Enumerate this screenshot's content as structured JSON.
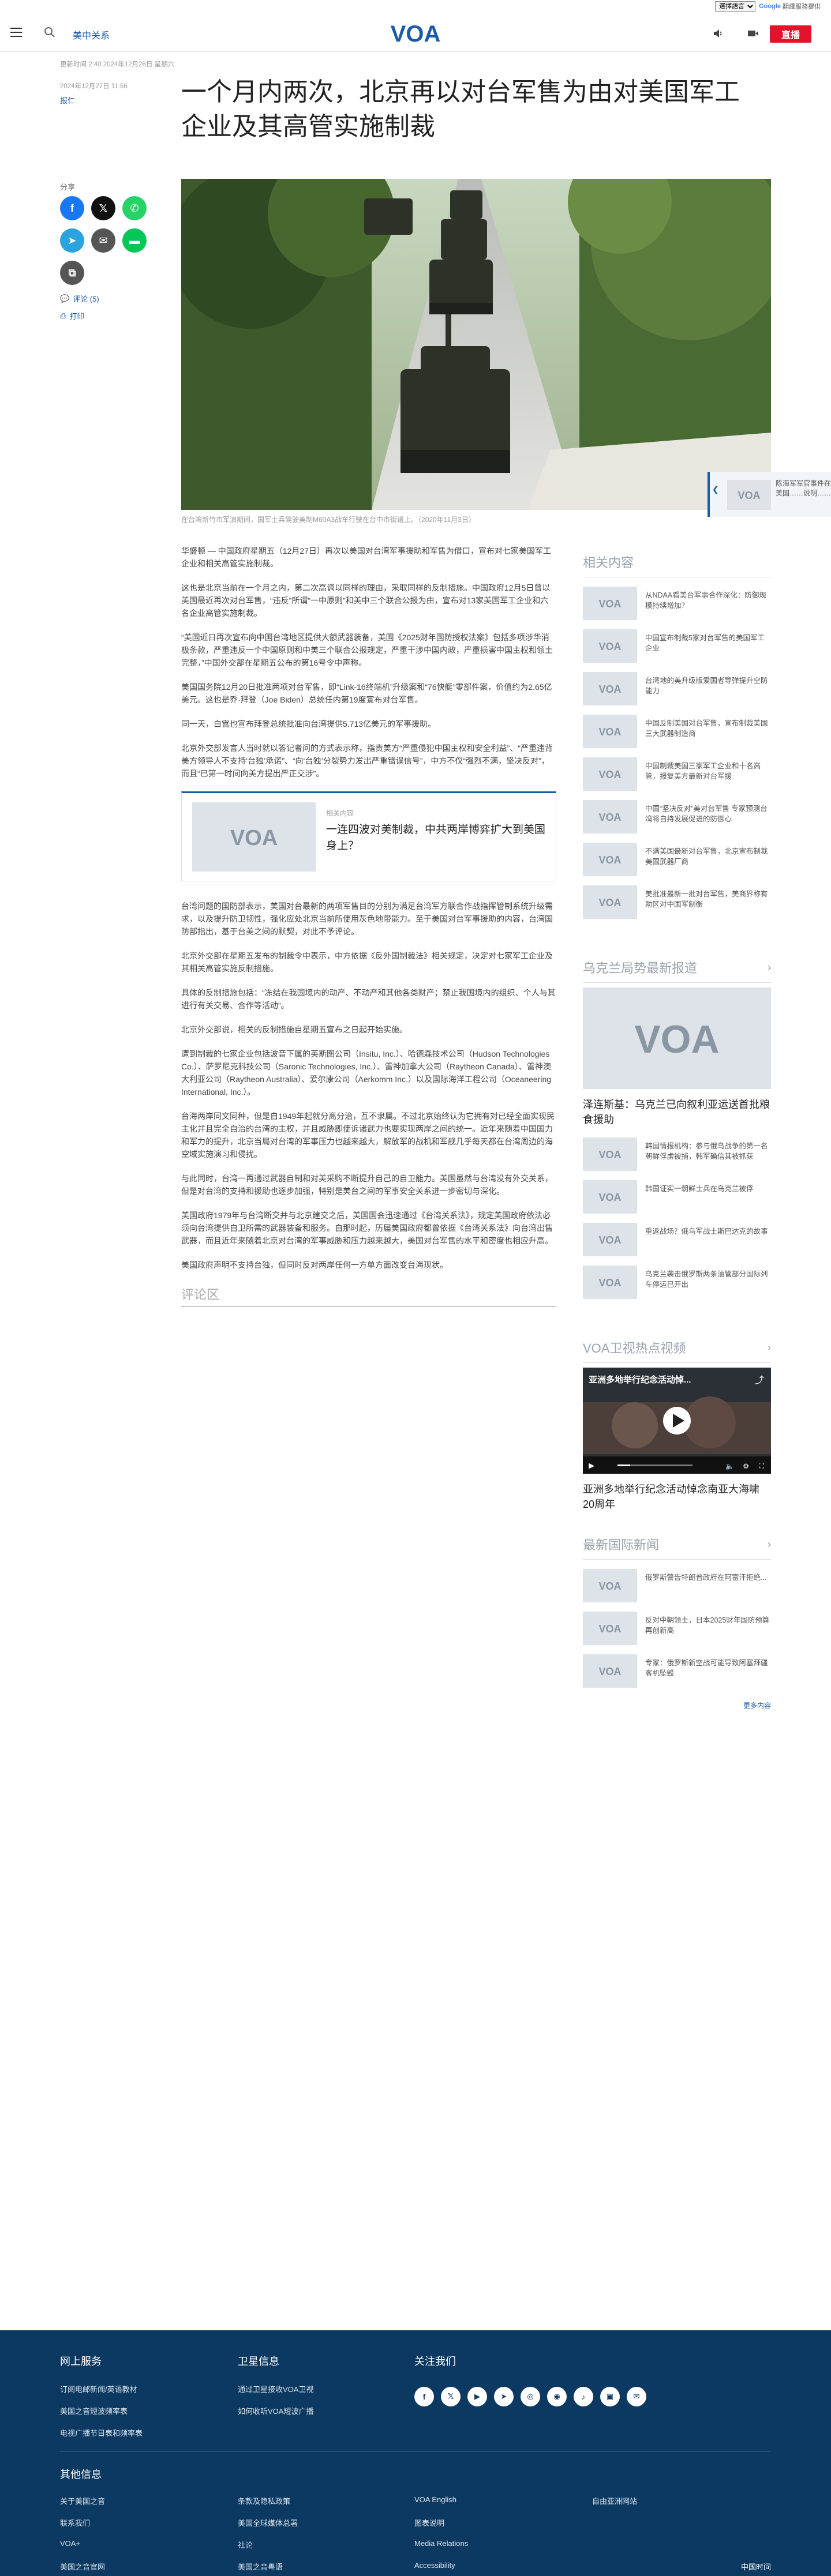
{
  "translate": {
    "select_label": "選擇語言",
    "powered": "Google",
    "service": "翻譯服務提供"
  },
  "header": {
    "section": "美中关系",
    "logo_text": "VOA",
    "live": "直播"
  },
  "meta": {
    "updated": "更新时间 2:40 2024年12月28日 星期六",
    "published": "2024年12月27日 11:56",
    "tag": "报仁"
  },
  "article_title": "一个月内两次，北京再以对台军售为由对美国军工企业及其高管实施制裁",
  "share": {
    "label": "分享",
    "comments": "评论 (5)",
    "print": "打印"
  },
  "hero": {
    "caption": "在台湾新竹市军演期间，国军士兵驾驶美制M60A3战车行驶在台中市街道上。（2020年11月3日）"
  },
  "floating_related": {
    "text": "陈海军军官事件在美国……说明……"
  },
  "article": {
    "paragraphs": [
      "华盛顿 — 中国政府星期五（12月27日）再次以美国对台湾军事援助和军售为借口，宣布对七家美国军工企业和相关高管实施制裁。",
      "这也是北京当前在一个月之内，第二次高调以同样的理由，采取同样的反制措施。中国政府12月5日曾以美国最近再次对台军售，“违反”所谓“一中原则”和美中三个联合公报为由，宣布对13家美国军工企业和六名企业高管实施制裁。",
      "“美国近日再次宣布向中国台湾地区提供大额武器装备，美国《2025财年国防授权法案》包括多项涉华消极条款，严重违反一个中国原则和中美三个联合公报规定，严重干涉中国内政，严重损害中国主权和领土完整，”中国外交部在星期五公布的第16号令中声称。",
      "美国国务院12月20日批准两项对台军售，即“Link-16终端机”升级案和“76快艇”零部件案，价值约为2.65亿美元。这也是乔·拜登（Joe Biden）总统任内第19度宣布对台军售。",
      "同一天，白宫也宣布拜登总统批准向台湾提供5.713亿美元的军事援助。",
      "北京外交部发言人当时就以答记者问的方式表示称，指责美方“严重侵犯中国主权和安全利益”、“严重违背美方领导人不支持‘台独’承诺”、“向‘台独’分裂势力发出严重错误信号”，中方不仅“强烈不满，坚决反对”，而且“已第一时间向美方提出严正交涉”。"
    ],
    "related_box": {
      "label": "相关内容",
      "title": "一连四波对美制裁，中共两岸博弈扩大到美国身上？"
    },
    "paragraphs2": [
      "台湾问题的国防部表示，美国对台最新的两项军售目的分别为满足台湾军方联合作战指挥管制系统升级需求，以及提升防卫韧性，强化应处北京当前所使用灰色地带能力。至于美国对台军事援助的内容，台湾国防部指出，基于台美之间的默契，对此不予评论。",
      "北京外交部在星期五发布的制裁令中表示，中方依据《反外国制裁法》相关规定，决定对七家军工企业及其相关高管实施反制措施。",
      "具体的反制措施包括：“冻结在我国境内的动产、不动产和其他各类财产；禁止我国境内的组织、个人与其进行有关交易、合作等活动”。",
      "北京外交部说，相关的反制措施自星期五宣布之日起开始实施。",
      "遭到制裁的七家企业包括波音下属的英斯图公司（Insitu, Inc.）、哈德森技术公司（Hudson Technologies Co.）、萨罗尼克科技公司（Saronic Technologies, Inc.）、雷神加拿大公司（Raytheon Canada）、雷神澳大利亚公司（Raytheon Australia）、爱尔康公司（Aerkomm Inc.）以及国际海洋工程公司（Oceaneering International, Inc.）。",
      "台海两岸同文同种，但是自1949年起就分离分治，互不隶属。不过北京始终认为它拥有对已经全面实现民主化并且完全自治的台湾的主权，并且威胁即使诉诸武力也要实现两岸之间的统一。近年来随着中国国力和军力的提升，北京当局对台湾的军事压力也越来越大，解放军的战机和军舰几乎每天都在台湾周边的海空域实施演习和侵扰。",
      "与此同时，台湾一再通过武器自制和对美采购不断提升自己的自卫能力。美国虽然与台湾没有外交关系，但是对台湾的支持和援助也逐步加强，特别是美台之间的军事安全关系进一步密切与深化。",
      "美国政府1979年与台湾断交并与北京建交之后，美国国会迅速通过《台湾关系法》，规定美国政府依法必须向台湾提供自卫所需的武器装备和服务。自那时起，历届美国政府都曾依据《台湾关系法》向台湾出售武器，而且近年来随着北京对台湾的军事威胁和压力越来越大，美国对台军售的水平和密度也相应升高。",
      "美国政府声明不支持台独，但同时反对两岸任何一方单方面改变台海现状。"
    ],
    "comments": "评论区"
  },
  "sidebar": {
    "related_head": "相关内容",
    "related": [
      "从NDAA看美台军事合作深化：防御规模持续增加？",
      "中国宣布制裁5家对台军售的美国军工企业",
      "台湾地的美升级版爱国者导弹提升空防能力",
      "中国反制美国对台军售，宣布制裁美国三大武器制造商",
      "中国制裁美国三家军工企业和十名高管，报复美方最新对台军援",
      "中国“坚决反对”美对台军售 专家预测台湾将自持发展促进的防御心",
      "不满美国最新对台军售，北京宣布制裁美国武器厂商",
      "美批准最新一批对台军售，美商界称有助区对中国军制衡"
    ],
    "ukraine_head": "乌克兰局势最新报道",
    "ukraine_feature": "泽连斯基：乌克兰已向叙利亚运送首批粮食援助",
    "ukraine": [
      "韩国情报机构：参与俄乌战争的第一名朝鲜俘虏被捕，韩军确信其被抓获",
      "韩国证实一朝鲜士兵在乌克兰被俘",
      "重返战场？俄乌军战士斯巴达克的故事",
      "乌克兰袭击俄罗斯两条油管部分国际列车停运已开出"
    ],
    "video_head": "VOA卫视热点视频",
    "video_title": "亚洲多地举行纪念活动悼念南亚大海啸20周年",
    "video_overlay": "亚洲多地举行纪念活动悼...",
    "news_head": "最新国际新闻",
    "news": [
      "俄罗斯警告特朗普政府在阿富汗拒绝...",
      "反对中朝领土，日本2025财年国防预算再创新高",
      "专家：俄罗斯新空战可能导致阿塞拜疆客机坠毁"
    ],
    "more": "更多内容"
  },
  "footer": {
    "col1_head": "网上服务",
    "col1": [
      "订阅电邮新闻/英语教材",
      "美国之音短波频率表",
      "电视广播节目表和频率表"
    ],
    "col2_head": "卫星信息",
    "col2": [
      "通过卫星接收VOA卫视",
      "如何收听VOA短波广播"
    ],
    "col3_head": "关注我们",
    "col4_head": "其他信息",
    "links_a": [
      "关于美国之音",
      "联系我们",
      "VOA+",
      "美国之音官网"
    ],
    "links_b": [
      "条款及隐私政策",
      "美国全球媒体总署",
      "社论",
      "美国之音粤语"
    ],
    "links_c": [
      "VOA English",
      "图表说明",
      "Media Relations",
      "Accessibility"
    ],
    "links_d": [
      "自由亚洲网站"
    ],
    "bottom": "中国时间"
  }
}
